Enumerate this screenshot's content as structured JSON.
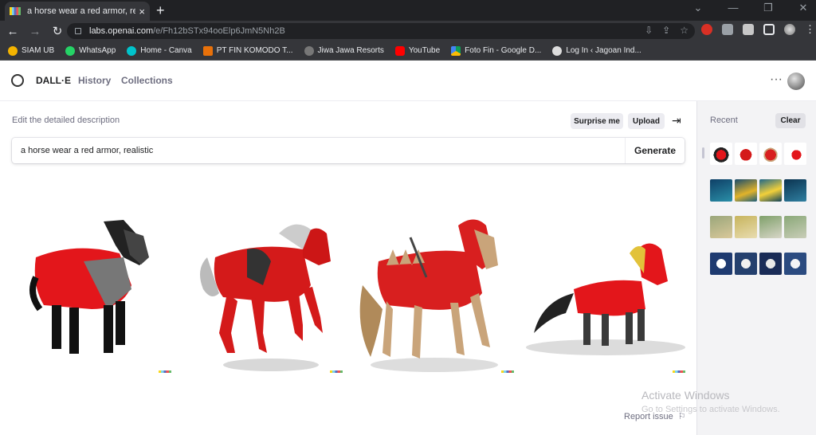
{
  "browser": {
    "tab_title": "a horse wear a red armor, realisti",
    "tab_close": "×",
    "new_tab": "+",
    "url_host": "labs.openai.com",
    "url_path": "/e/Fh12bSTx94ooElp6JmN5Nh2B",
    "bookmarks": [
      "SIAM UB",
      "WhatsApp",
      "Home - Canva",
      "PT FIN KOMODO T...",
      "Jiwa Jawa Resorts",
      "YouTube",
      "Foto Fin - Google D...",
      "Log In ‹ Jagoan Ind..."
    ]
  },
  "nav": {
    "brand": "DALL·E",
    "history": "History",
    "collections": "Collections",
    "more": "···"
  },
  "editor": {
    "label": "Edit the detailed description",
    "surprise": "Surprise me",
    "upload": "Upload",
    "prompt": "a horse wear a red armor, realistic",
    "generate": "Generate"
  },
  "sidebar": {
    "recent": "Recent",
    "clear": "Clear"
  },
  "footer": {
    "watermark_title": "Activate Windows",
    "watermark_sub": "Go to Settings to activate Windows.",
    "report": "Report issue"
  },
  "colors": {
    "armor_red": "#e3161b",
    "accent": "#202123"
  }
}
